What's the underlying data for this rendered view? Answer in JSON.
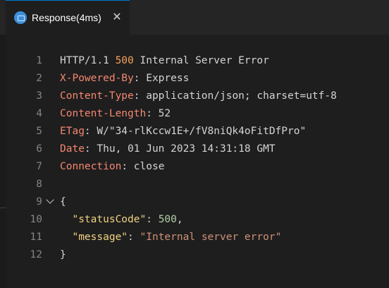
{
  "tab": {
    "title": "Response(4ms)",
    "close_symbol": "✕",
    "icon": "http-response-icon"
  },
  "lines": [
    {
      "n": "1",
      "seg": [
        {
          "t": "HTTP/1.1 "
        },
        {
          "t": "500",
          "c": "num"
        },
        {
          "t": " Internal Server Error"
        }
      ]
    },
    {
      "n": "2",
      "seg": [
        {
          "t": "X-Powered-By",
          "c": "k"
        },
        {
          "t": ": Express"
        }
      ]
    },
    {
      "n": "3",
      "seg": [
        {
          "t": "Content-Type",
          "c": "k"
        },
        {
          "t": ": application/json; charset=utf-8"
        }
      ]
    },
    {
      "n": "4",
      "seg": [
        {
          "t": "Content-Length",
          "c": "k"
        },
        {
          "t": ": 52"
        }
      ]
    },
    {
      "n": "5",
      "seg": [
        {
          "t": "ETag",
          "c": "k"
        },
        {
          "t": ": W/\"34-rlKccw1E+/fV8niQk4oFitDfPro\""
        }
      ]
    },
    {
      "n": "6",
      "seg": [
        {
          "t": "Date",
          "c": "k"
        },
        {
          "t": ": Thu, 01 Jun 2023 14:31:18 GMT"
        }
      ]
    },
    {
      "n": "7",
      "seg": [
        {
          "t": "Connection",
          "c": "k"
        },
        {
          "t": ": close"
        }
      ]
    },
    {
      "n": "8",
      "seg": []
    },
    {
      "n": "9",
      "fold": true,
      "seg": [
        {
          "t": "{"
        }
      ]
    },
    {
      "n": "10",
      "seg": [
        {
          "t": "  "
        },
        {
          "t": "\"statusCode\"",
          "c": "json-key"
        },
        {
          "t": ": "
        },
        {
          "t": "500",
          "c": "num2"
        },
        {
          "t": ","
        }
      ]
    },
    {
      "n": "11",
      "seg": [
        {
          "t": "  "
        },
        {
          "t": "\"message\"",
          "c": "json-key"
        },
        {
          "t": ": "
        },
        {
          "t": "\"Internal server error\"",
          "c": "str"
        }
      ]
    },
    {
      "n": "12",
      "seg": [
        {
          "t": "}"
        }
      ]
    }
  ]
}
